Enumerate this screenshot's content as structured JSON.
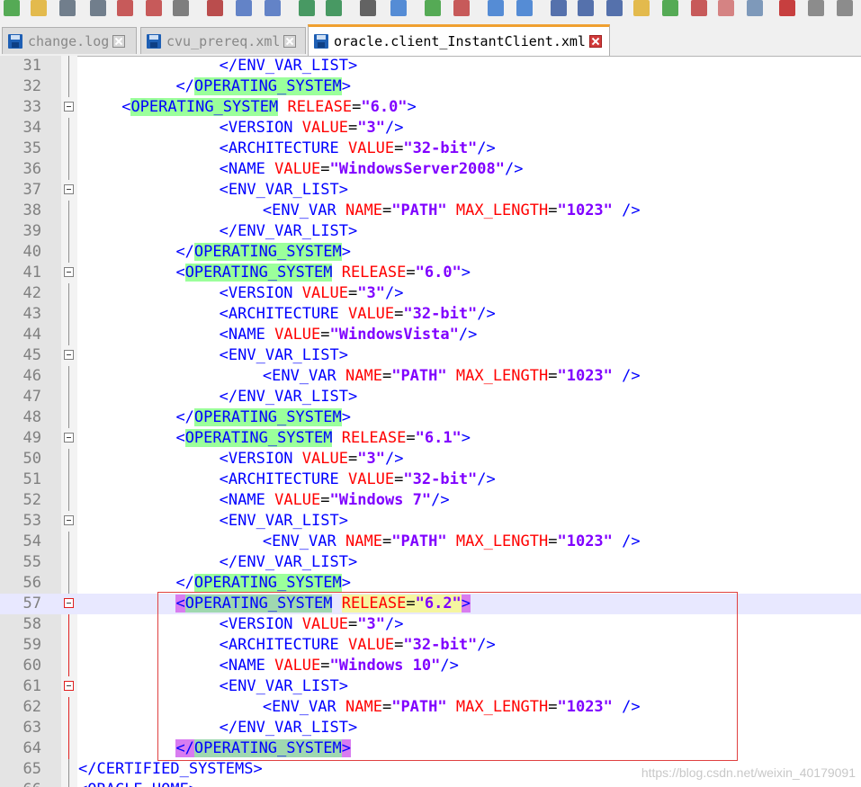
{
  "tabs": [
    {
      "label": "change.log",
      "active": false
    },
    {
      "label": "cvu_prereq.xml",
      "active": false
    },
    {
      "label": "oracle.client_InstantClient.xml",
      "active": true
    }
  ],
  "toolbar": {
    "icons": [
      "new-file-icon",
      "open-folder-icon",
      "save-icon",
      "save-all-icon",
      "close-icon",
      "close-all-icon",
      "print-icon",
      "cut-icon",
      "copy-icon",
      "paste-icon",
      "undo-icon",
      "redo-icon",
      "find-icon",
      "replace-icon",
      "zoom-in-icon",
      "zoom-out-icon",
      "sync-v-icon",
      "sync-h-icon",
      "word-wrap-icon",
      "show-all-chars-icon",
      "indent-guide-icon",
      "language-icon",
      "doc-map-icon",
      "function-list-icon",
      "folder-workspace-icon",
      "monitor-icon",
      "record-macro-icon",
      "stop-macro-icon",
      "play-macro-icon"
    ]
  },
  "editor": {
    "current_line": 57,
    "lines": [
      {
        "n": "31",
        "indent": 13,
        "tokens": [
          [
            "punc",
            "</"
          ],
          [
            "tag",
            "ENV_VAR_LIST"
          ],
          [
            "punc",
            ">"
          ]
        ]
      },
      {
        "n": "32",
        "indent": 9,
        "tokens": [
          [
            "punc",
            "</"
          ],
          [
            "tag hl",
            "OPERATING_SYSTEM"
          ],
          [
            "punc",
            ">"
          ]
        ]
      },
      {
        "n": "33",
        "indent": 4,
        "fold": true,
        "tokens": [
          [
            "punc",
            "<"
          ],
          [
            "tag hl",
            "OPERATING_SYSTEM"
          ],
          [
            "eq",
            " "
          ],
          [
            "attr",
            "RELEASE"
          ],
          [
            "eq",
            "="
          ],
          [
            "val",
            "\"6.0\""
          ],
          [
            "punc",
            ">"
          ]
        ]
      },
      {
        "n": "34",
        "indent": 13,
        "tokens": [
          [
            "punc",
            "<"
          ],
          [
            "tag",
            "VERSION"
          ],
          [
            "eq",
            " "
          ],
          [
            "attr",
            "VALUE"
          ],
          [
            "eq",
            "="
          ],
          [
            "val",
            "\"3\""
          ],
          [
            "punc",
            "/>"
          ]
        ]
      },
      {
        "n": "35",
        "indent": 13,
        "tokens": [
          [
            "punc",
            "<"
          ],
          [
            "tag",
            "ARCHITECTURE"
          ],
          [
            "eq",
            " "
          ],
          [
            "attr",
            "VALUE"
          ],
          [
            "eq",
            "="
          ],
          [
            "val",
            "\"32-bit\""
          ],
          [
            "punc",
            "/>"
          ]
        ]
      },
      {
        "n": "36",
        "indent": 13,
        "tokens": [
          [
            "punc",
            "<"
          ],
          [
            "tag",
            "NAME"
          ],
          [
            "eq",
            " "
          ],
          [
            "attr",
            "VALUE"
          ],
          [
            "eq",
            "="
          ],
          [
            "val",
            "\"WindowsServer2008\""
          ],
          [
            "punc",
            "/>"
          ]
        ]
      },
      {
        "n": "37",
        "indent": 13,
        "fold": true,
        "tokens": [
          [
            "punc",
            "<"
          ],
          [
            "tag",
            "ENV_VAR_LIST"
          ],
          [
            "punc",
            ">"
          ]
        ]
      },
      {
        "n": "38",
        "indent": 17,
        "tokens": [
          [
            "punc",
            "<"
          ],
          [
            "tag",
            "ENV_VAR"
          ],
          [
            "eq",
            " "
          ],
          [
            "attr",
            "NAME"
          ],
          [
            "eq",
            "="
          ],
          [
            "val",
            "\"PATH\""
          ],
          [
            "eq",
            " "
          ],
          [
            "attr",
            "MAX_LENGTH"
          ],
          [
            "eq",
            "="
          ],
          [
            "val",
            "\"1023\""
          ],
          [
            "eq",
            " "
          ],
          [
            "punc",
            "/>"
          ]
        ]
      },
      {
        "n": "39",
        "indent": 13,
        "tokens": [
          [
            "punc",
            "</"
          ],
          [
            "tag",
            "ENV_VAR_LIST"
          ],
          [
            "punc",
            ">"
          ]
        ]
      },
      {
        "n": "40",
        "indent": 9,
        "tokens": [
          [
            "punc",
            "</"
          ],
          [
            "tag hl",
            "OPERATING_SYSTEM"
          ],
          [
            "punc",
            ">"
          ]
        ]
      },
      {
        "n": "41",
        "indent": 9,
        "fold": true,
        "tokens": [
          [
            "punc",
            "<"
          ],
          [
            "tag hl",
            "OPERATING_SYSTEM"
          ],
          [
            "eq",
            " "
          ],
          [
            "attr",
            "RELEASE"
          ],
          [
            "eq",
            "="
          ],
          [
            "val",
            "\"6.0\""
          ],
          [
            "punc",
            ">"
          ]
        ]
      },
      {
        "n": "42",
        "indent": 13,
        "tokens": [
          [
            "punc",
            "<"
          ],
          [
            "tag",
            "VERSION"
          ],
          [
            "eq",
            " "
          ],
          [
            "attr",
            "VALUE"
          ],
          [
            "eq",
            "="
          ],
          [
            "val",
            "\"3\""
          ],
          [
            "punc",
            "/>"
          ]
        ]
      },
      {
        "n": "43",
        "indent": 13,
        "tokens": [
          [
            "punc",
            "<"
          ],
          [
            "tag",
            "ARCHITECTURE"
          ],
          [
            "eq",
            " "
          ],
          [
            "attr",
            "VALUE"
          ],
          [
            "eq",
            "="
          ],
          [
            "val",
            "\"32-bit\""
          ],
          [
            "punc",
            "/>"
          ]
        ]
      },
      {
        "n": "44",
        "indent": 13,
        "tokens": [
          [
            "punc",
            "<"
          ],
          [
            "tag",
            "NAME"
          ],
          [
            "eq",
            " "
          ],
          [
            "attr",
            "VALUE"
          ],
          [
            "eq",
            "="
          ],
          [
            "val",
            "\"WindowsVista\""
          ],
          [
            "punc",
            "/>"
          ]
        ]
      },
      {
        "n": "45",
        "indent": 13,
        "fold": true,
        "tokens": [
          [
            "punc",
            "<"
          ],
          [
            "tag",
            "ENV_VAR_LIST"
          ],
          [
            "punc",
            ">"
          ]
        ]
      },
      {
        "n": "46",
        "indent": 17,
        "tokens": [
          [
            "punc",
            "<"
          ],
          [
            "tag",
            "ENV_VAR"
          ],
          [
            "eq",
            " "
          ],
          [
            "attr",
            "NAME"
          ],
          [
            "eq",
            "="
          ],
          [
            "val",
            "\"PATH\""
          ],
          [
            "eq",
            " "
          ],
          [
            "attr",
            "MAX_LENGTH"
          ],
          [
            "eq",
            "="
          ],
          [
            "val",
            "\"1023\""
          ],
          [
            "eq",
            " "
          ],
          [
            "punc",
            "/>"
          ]
        ]
      },
      {
        "n": "47",
        "indent": 13,
        "tokens": [
          [
            "punc",
            "</"
          ],
          [
            "tag",
            "ENV_VAR_LIST"
          ],
          [
            "punc",
            ">"
          ]
        ]
      },
      {
        "n": "48",
        "indent": 9,
        "tokens": [
          [
            "punc",
            "</"
          ],
          [
            "tag hl",
            "OPERATING_SYSTEM"
          ],
          [
            "punc",
            ">"
          ]
        ]
      },
      {
        "n": "49",
        "indent": 9,
        "fold": true,
        "tokens": [
          [
            "punc",
            "<"
          ],
          [
            "tag hl",
            "OPERATING_SYSTEM"
          ],
          [
            "eq",
            " "
          ],
          [
            "attr",
            "RELEASE"
          ],
          [
            "eq",
            "="
          ],
          [
            "val",
            "\"6.1\""
          ],
          [
            "punc",
            ">"
          ]
        ]
      },
      {
        "n": "50",
        "indent": 13,
        "tokens": [
          [
            "punc",
            "<"
          ],
          [
            "tag",
            "VERSION"
          ],
          [
            "eq",
            " "
          ],
          [
            "attr",
            "VALUE"
          ],
          [
            "eq",
            "="
          ],
          [
            "val",
            "\"3\""
          ],
          [
            "punc",
            "/>"
          ]
        ]
      },
      {
        "n": "51",
        "indent": 13,
        "tokens": [
          [
            "punc",
            "<"
          ],
          [
            "tag",
            "ARCHITECTURE"
          ],
          [
            "eq",
            " "
          ],
          [
            "attr",
            "VALUE"
          ],
          [
            "eq",
            "="
          ],
          [
            "val",
            "\"32-bit\""
          ],
          [
            "punc",
            "/>"
          ]
        ]
      },
      {
        "n": "52",
        "indent": 13,
        "tokens": [
          [
            "punc",
            "<"
          ],
          [
            "tag",
            "NAME"
          ],
          [
            "eq",
            " "
          ],
          [
            "attr",
            "VALUE"
          ],
          [
            "eq",
            "="
          ],
          [
            "val",
            "\"Windows 7\""
          ],
          [
            "punc",
            "/>"
          ]
        ]
      },
      {
        "n": "53",
        "indent": 13,
        "fold": true,
        "tokens": [
          [
            "punc",
            "<"
          ],
          [
            "tag",
            "ENV_VAR_LIST"
          ],
          [
            "punc",
            ">"
          ]
        ]
      },
      {
        "n": "54",
        "indent": 17,
        "tokens": [
          [
            "punc",
            "<"
          ],
          [
            "tag",
            "ENV_VAR"
          ],
          [
            "eq",
            " "
          ],
          [
            "attr",
            "NAME"
          ],
          [
            "eq",
            "="
          ],
          [
            "val",
            "\"PATH\""
          ],
          [
            "eq",
            " "
          ],
          [
            "attr",
            "MAX_LENGTH"
          ],
          [
            "eq",
            "="
          ],
          [
            "val",
            "\"1023\""
          ],
          [
            "eq",
            " "
          ],
          [
            "punc",
            "/>"
          ]
        ]
      },
      {
        "n": "55",
        "indent": 13,
        "tokens": [
          [
            "punc",
            "</"
          ],
          [
            "tag",
            "ENV_VAR_LIST"
          ],
          [
            "punc",
            ">"
          ]
        ]
      },
      {
        "n": "56",
        "indent": 9,
        "tokens": [
          [
            "punc",
            "</"
          ],
          [
            "tag hl",
            "OPERATING_SYSTEM"
          ],
          [
            "punc",
            ">"
          ]
        ]
      },
      {
        "n": "57",
        "indent": 9,
        "fold": true,
        "foldred": true,
        "tokens": [
          [
            "punc mark-pink",
            "<"
          ],
          [
            "tag hl2",
            "OPERATING_SYSTEM"
          ],
          [
            "eq",
            " "
          ],
          [
            "attr mark-yellow",
            "RELEASE"
          ],
          [
            "eq mark-yellow",
            "="
          ],
          [
            "val mark-yellow",
            "\"6.2\""
          ],
          [
            "punc mark-pink",
            ">"
          ]
        ]
      },
      {
        "n": "58",
        "indent": 13,
        "tokens": [
          [
            "punc",
            "<"
          ],
          [
            "tag",
            "VERSION"
          ],
          [
            "eq",
            " "
          ],
          [
            "attr",
            "VALUE"
          ],
          [
            "eq",
            "="
          ],
          [
            "val",
            "\"3\""
          ],
          [
            "punc",
            "/>"
          ]
        ]
      },
      {
        "n": "59",
        "indent": 13,
        "tokens": [
          [
            "punc",
            "<"
          ],
          [
            "tag",
            "ARCHITECTURE"
          ],
          [
            "eq",
            " "
          ],
          [
            "attr",
            "VALUE"
          ],
          [
            "eq",
            "="
          ],
          [
            "val",
            "\"32-bit\""
          ],
          [
            "punc",
            "/>"
          ]
        ]
      },
      {
        "n": "60",
        "indent": 13,
        "tokens": [
          [
            "punc",
            "<"
          ],
          [
            "tag",
            "NAME"
          ],
          [
            "eq",
            " "
          ],
          [
            "attr",
            "VALUE"
          ],
          [
            "eq",
            "="
          ],
          [
            "val",
            "\"Windows 10\""
          ],
          [
            "punc",
            "/>"
          ]
        ]
      },
      {
        "n": "61",
        "indent": 13,
        "fold": true,
        "foldred": true,
        "tokens": [
          [
            "punc",
            "<"
          ],
          [
            "tag",
            "ENV_VAR_LIST"
          ],
          [
            "punc",
            ">"
          ]
        ]
      },
      {
        "n": "62",
        "indent": 17,
        "tokens": [
          [
            "punc",
            "<"
          ],
          [
            "tag",
            "ENV_VAR"
          ],
          [
            "eq",
            " "
          ],
          [
            "attr",
            "NAME"
          ],
          [
            "eq",
            "="
          ],
          [
            "val",
            "\"PATH\""
          ],
          [
            "eq",
            " "
          ],
          [
            "attr",
            "MAX_LENGTH"
          ],
          [
            "eq",
            "="
          ],
          [
            "val",
            "\"1023\""
          ],
          [
            "eq",
            " "
          ],
          [
            "punc",
            "/>"
          ]
        ]
      },
      {
        "n": "63",
        "indent": 13,
        "tokens": [
          [
            "punc",
            "</"
          ],
          [
            "tag",
            "ENV_VAR_LIST"
          ],
          [
            "punc",
            ">"
          ]
        ]
      },
      {
        "n": "64",
        "indent": 9,
        "tokens": [
          [
            "punc mark-pink",
            "</"
          ],
          [
            "tag hl2",
            "OPERATING_SYSTEM"
          ],
          [
            "punc mark-pink",
            ">"
          ]
        ]
      },
      {
        "n": "65",
        "indent": 0,
        "tokens": [
          [
            "punc",
            "</"
          ],
          [
            "tag",
            "CERTIFIED_SYSTEMS"
          ],
          [
            "punc",
            ">"
          ]
        ]
      },
      {
        "n": "66",
        "indent": 0,
        "tokens": [
          [
            "punc",
            "<"
          ],
          [
            "tag",
            "ORACLE_HOME"
          ],
          [
            "punc",
            ">"
          ]
        ]
      }
    ]
  },
  "watermark": "https://blog.csdn.net/weixin_40179091"
}
